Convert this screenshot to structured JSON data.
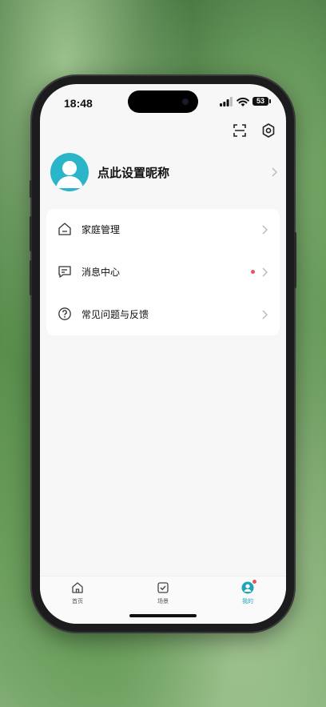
{
  "status_bar": {
    "time": "18:48",
    "battery": "53"
  },
  "profile": {
    "nickname": "点此设置昵称"
  },
  "menu": {
    "items": [
      {
        "label": "家庭管理",
        "icon": "home-icon",
        "has_dot": false
      },
      {
        "label": "消息中心",
        "icon": "message-icon",
        "has_dot": true
      },
      {
        "label": "常见问题与反馈",
        "icon": "help-icon",
        "has_dot": false
      }
    ]
  },
  "tabbar": {
    "tabs": [
      {
        "label": "首页",
        "icon": "home-tab-icon",
        "active": false
      },
      {
        "label": "场景",
        "icon": "scene-check-icon",
        "active": false
      },
      {
        "label": "我的",
        "icon": "profile-tab-icon",
        "active": true
      }
    ]
  },
  "colors": {
    "accent": "#1fa4b8",
    "avatar": "#2ab6c8",
    "badge": "#e05a5a"
  }
}
